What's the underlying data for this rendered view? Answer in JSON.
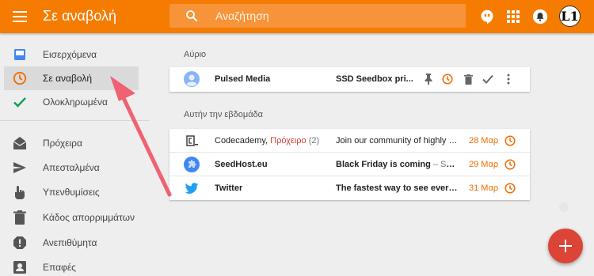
{
  "header": {
    "title": "Σε αναβολή",
    "search_placeholder": "Αναζήτηση",
    "avatar_letter": "L1",
    "colors": {
      "bar": "#f57c00",
      "search_bg": "#f7943a"
    }
  },
  "sidebar": {
    "items": [
      {
        "label": "Εισερχόμενα",
        "icon": "inbox-icon"
      },
      {
        "label": "Σε αναβολή",
        "icon": "clock-icon",
        "active": true
      },
      {
        "label": "Ολοκληρωμένα",
        "icon": "check-icon"
      },
      {
        "label": "Πρόχειρα",
        "icon": "drafts-icon"
      },
      {
        "label": "Απεσταλμένα",
        "icon": "send-icon"
      },
      {
        "label": "Υπενθυμίσεις",
        "icon": "reminder-hand-icon"
      },
      {
        "label": "Κάδος απορριμμάτων",
        "icon": "trash-icon"
      },
      {
        "label": "Ανεπιθύμητα",
        "icon": "spam-icon"
      },
      {
        "label": "Επαφές",
        "icon": "contacts-icon"
      }
    ]
  },
  "main": {
    "tomorrow": {
      "label": "Αύριο",
      "rows": [
        {
          "sender": "Pulsed Media",
          "subject": "SSD Seedbox pri...",
          "icon": "person-avatar-icon"
        }
      ]
    },
    "this_week": {
      "label": "Αυτήν την εβδομάδα",
      "rows": [
        {
          "sender": "Codecademy,",
          "draft_label": "Πρόχειρο",
          "count": "(2)",
          "subject": "Join our community of highly mo...",
          "snippet": "",
          "date": "28 Μαρ",
          "icon": "codecademy-icon"
        },
        {
          "sender": "SeedHost.eu",
          "subject": "Black Friday is coming",
          "snippet": " – Seed...",
          "date": "29 Μαρ",
          "icon": "puzzle-icon"
        },
        {
          "sender": "Twitter",
          "subject": "The fastest way to see every s...",
          "snippet": "",
          "date": "31 Μαρ",
          "icon": "twitter-icon"
        }
      ]
    }
  },
  "fab": {
    "label": "+"
  },
  "accent_colors": {
    "orange": "#ef6c00",
    "fab": "#db4437",
    "check": "#0f9d58",
    "inbox": "#4285f4",
    "arrow": "#f06272"
  }
}
